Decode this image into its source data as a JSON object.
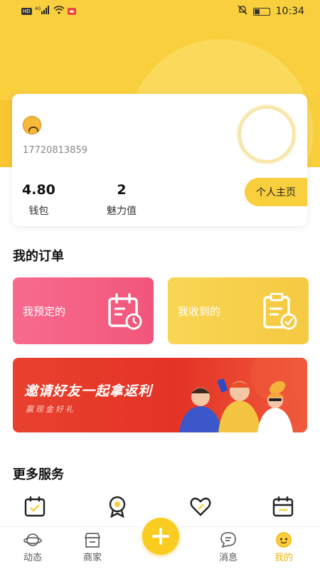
{
  "status_bar": {
    "network_tag": "HD",
    "signal": "4G",
    "time": "10:34",
    "icons": [
      "hd-icon",
      "signal-icon",
      "wifi-icon",
      "app-notification-icon",
      "mute-icon",
      "battery-icon"
    ]
  },
  "profile": {
    "phone": "17720813859",
    "wallet_value": "4.80",
    "wallet_label": "钱包",
    "charm_value": "2",
    "charm_label": "魅力值",
    "profile_button": "个人主页"
  },
  "orders": {
    "title": "我的订单",
    "booked_label": "我预定的",
    "received_label": "我收到的"
  },
  "banner": {
    "title": "邀请好友一起拿返利",
    "subtitle": "赢现金好礼"
  },
  "services": {
    "title": "更多服务",
    "icons": [
      "calendar-icon",
      "medal-icon",
      "heart-icon",
      "calendar-icon"
    ]
  },
  "tabbar": {
    "items": [
      {
        "label": "动态",
        "icon": "planet-icon"
      },
      {
        "label": "商家",
        "icon": "store-icon"
      },
      {
        "label": "消息",
        "icon": "chat-icon"
      },
      {
        "label": "我的",
        "icon": "face-icon",
        "active": true
      }
    ],
    "center_icon": "plus-icon"
  },
  "colors": {
    "accent": "#f9cf3e",
    "pink": "#f1567a",
    "banner_red": "#e33326",
    "active_tab": "#f2b600"
  }
}
